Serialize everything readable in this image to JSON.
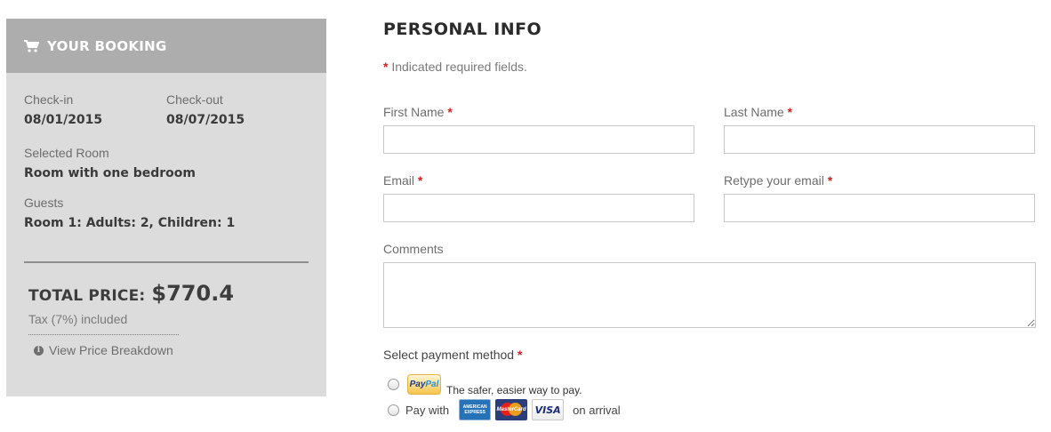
{
  "sidebar": {
    "title": "YOUR BOOKING",
    "checkin_label": "Check-in",
    "checkin_value": "08/01/2015",
    "checkout_label": "Check-out",
    "checkout_value": "08/07/2015",
    "room_label": "Selected Room",
    "room_value": "Room with one bedroom",
    "guests_label": "Guests",
    "guests_value": "Room 1: Adults: 2, Children: 1",
    "total_label": "TOTAL PRICE:",
    "total_value": "$770.4",
    "tax_note": "Tax (7%) included",
    "breakdown_link": "View Price Breakdown",
    "header_color": "#adadad",
    "panel_color": "#dcdcdc"
  },
  "form": {
    "title": "PERSONAL INFO",
    "required_star": "*",
    "required_note": "Indicated required fields.",
    "first_name_label": "First Name",
    "last_name_label": "Last Name",
    "email_label": "Email",
    "retype_email_label": "Retype your email",
    "comments_label": "Comments",
    "first_name_value": "",
    "last_name_value": "",
    "email_value": "",
    "retype_email_value": "",
    "comments_value": "",
    "required_color": "#cc2222"
  },
  "payment": {
    "title": "Select payment method",
    "paypal_logo_pay": "Pay",
    "paypal_logo_pal": "Pal",
    "paypal_text": "The safer, easier way to pay.",
    "pay_with": "Pay with",
    "amex_line1": "AMERICAN",
    "amex_line2": "EXPRESS",
    "mastercard_text": "MasterCard",
    "visa_text": "VISA",
    "on_arrival": "on arrival"
  }
}
